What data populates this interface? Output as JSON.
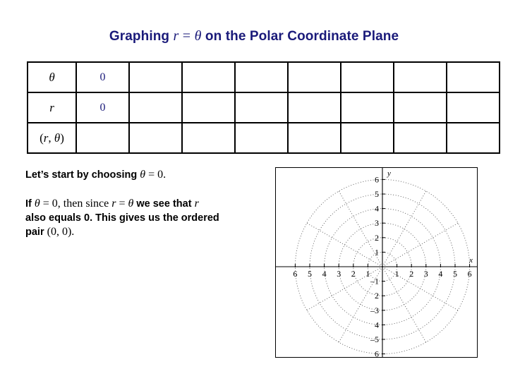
{
  "title": {
    "prefix": "Graphing",
    "math_r": "r",
    "equals": "=",
    "math_theta": "θ",
    "suffix": "on the Polar Coordinate Plane",
    "color": "#1a1a7a"
  },
  "table": {
    "row_labels": [
      "θ",
      "r",
      "(r, θ)"
    ],
    "pair_label_parts": {
      "open": "(",
      "r": "r",
      "comma": ", ",
      "theta": "θ",
      "close": ")"
    },
    "column_count": 8,
    "value_color": "#1a1a7a",
    "rows": [
      {
        "label": "θ",
        "values": [
          "0",
          "",
          "",
          "",
          "",
          "",
          "",
          ""
        ]
      },
      {
        "label": "r",
        "values": [
          "0",
          "",
          "",
          "",
          "",
          "",
          "",
          ""
        ]
      },
      {
        "label": "(r, θ)",
        "values": [
          "",
          "",
          "",
          "",
          "",
          "",
          "",
          ""
        ]
      }
    ]
  },
  "explanation": {
    "paragraph1": {
      "text_a": "Let’s start by choosing ",
      "theta": "θ",
      "eq": " = 0",
      "text_b": "."
    },
    "paragraph2": {
      "line1_a": "If ",
      "line1_theta1": "θ",
      "line1_b": " = 0, then since ",
      "line1_r": "r",
      "line1_c": " = ",
      "line1_theta2": "θ",
      "line1_d": " we see that ",
      "line1_r2": "r",
      "line2": "also equals 0.  This gives us the ordered",
      "line3_a": "pair ",
      "line3_pair": "(0, 0)",
      "line3_b": "."
    }
  },
  "chart_data": {
    "type": "scatter",
    "subtype": "polar-grid",
    "title": "",
    "xlabel": "x",
    "ylabel": "y",
    "xlim": [
      -6.8,
      6.8
    ],
    "ylim": [
      -6.6,
      6.6
    ],
    "grid": true,
    "grid_style": "dotted",
    "grid_color": "#555555",
    "axis_color": "#000000",
    "border": true,
    "polar_circle_radii": [
      1,
      2,
      3,
      4,
      5,
      6
    ],
    "radial_lines_degrees": [
      0,
      30,
      60,
      90,
      120,
      150,
      180,
      210,
      240,
      270,
      300,
      330
    ],
    "x_tick_labels_negative": [
      "6",
      "5",
      "4",
      "3",
      "2",
      "1"
    ],
    "x_tick_labels_positive": [
      "1",
      "2",
      "3",
      "4",
      "5",
      "6"
    ],
    "y_tick_labels_positive": [
      "6",
      "5",
      "4",
      "3",
      "2",
      "1"
    ],
    "y_tick_labels_negative": [
      "–1",
      "2",
      "–3",
      "4",
      "–5",
      "6"
    ],
    "axis_label_x": "x",
    "axis_label_y": "y",
    "series": [
      {
        "name": "r = θ",
        "points": []
      }
    ],
    "note": "empty polar coordinate plane; no curve plotted yet"
  }
}
